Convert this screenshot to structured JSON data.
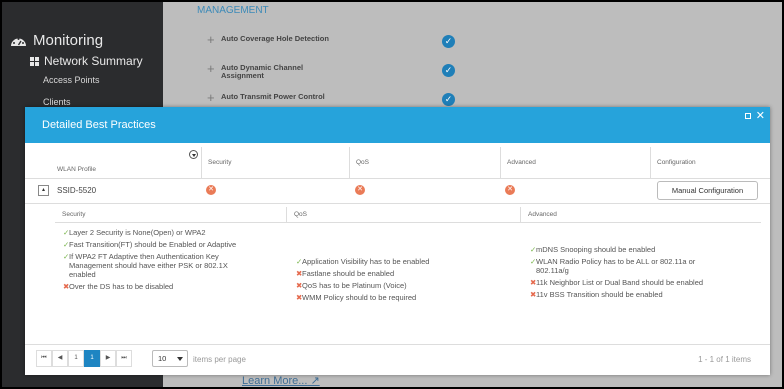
{
  "sidebar": {
    "monitoring": "Monitoring",
    "network_summary": "Network Summary",
    "items": [
      "Access Points",
      "Clients"
    ]
  },
  "background": {
    "section": "MANAGEMENT",
    "rows": [
      "Auto Coverage Hole Detection",
      "Auto Dynamic Channel Assignment",
      "Auto Transmit Power Control"
    ],
    "learn_more": "Learn More..."
  },
  "modal": {
    "title": "Detailed Best Practices",
    "columns": {
      "wlan_profile": "WLAN Profile",
      "security": "Security",
      "qos": "QoS",
      "advanced": "Advanced",
      "configuration": "Configuration"
    },
    "row": {
      "ssid": "SSID-5520",
      "button": "Manual Configuration"
    },
    "details": {
      "headers": {
        "security": "Security",
        "qos": "QoS",
        "advanced": "Advanced"
      },
      "security": [
        {
          "status": "ok",
          "text": "Layer 2 Security is None(Open) or WPA2"
        },
        {
          "status": "ok",
          "text": "Fast Transition(FT) should be Enabled or Adaptive"
        },
        {
          "status": "ok",
          "text": "If WPA2 FT Adaptive then Authentication Key Management should have either PSK or 802.1X enabled"
        },
        {
          "status": "bad",
          "text": "Over the DS has to be disabled"
        }
      ],
      "qos": [
        {
          "status": "ok",
          "text": "Application Visibility has to be enabled"
        },
        {
          "status": "bad",
          "text": "Fastlane should be enabled"
        },
        {
          "status": "bad",
          "text": "QoS has to be Platinum (Voice)"
        },
        {
          "status": "bad",
          "text": "WMM Policy should to be required"
        }
      ],
      "advanced": [
        {
          "status": "ok",
          "text": "mDNS Snooping should be enabled"
        },
        {
          "status": "ok",
          "text": "WLAN Radio Policy has to be ALL or 802.11a or 802.11a/g"
        },
        {
          "status": "bad",
          "text": "11k Neighbor List or Dual Band should be enabled"
        },
        {
          "status": "bad",
          "text": "11v BSS Transition should be enabled"
        }
      ]
    },
    "pager": {
      "first": "⏮",
      "prev": "◀",
      "prev_page": "1",
      "current": "1",
      "next": "▶",
      "last": "⏭",
      "page_size": "10",
      "items_per_page": "items per page",
      "count": "1 - 1 of 1 items"
    }
  },
  "colors": {
    "header": "#26a3db",
    "ok": "#78b54a",
    "bad": "#e56a4e",
    "active_page": "#1e85c2"
  }
}
